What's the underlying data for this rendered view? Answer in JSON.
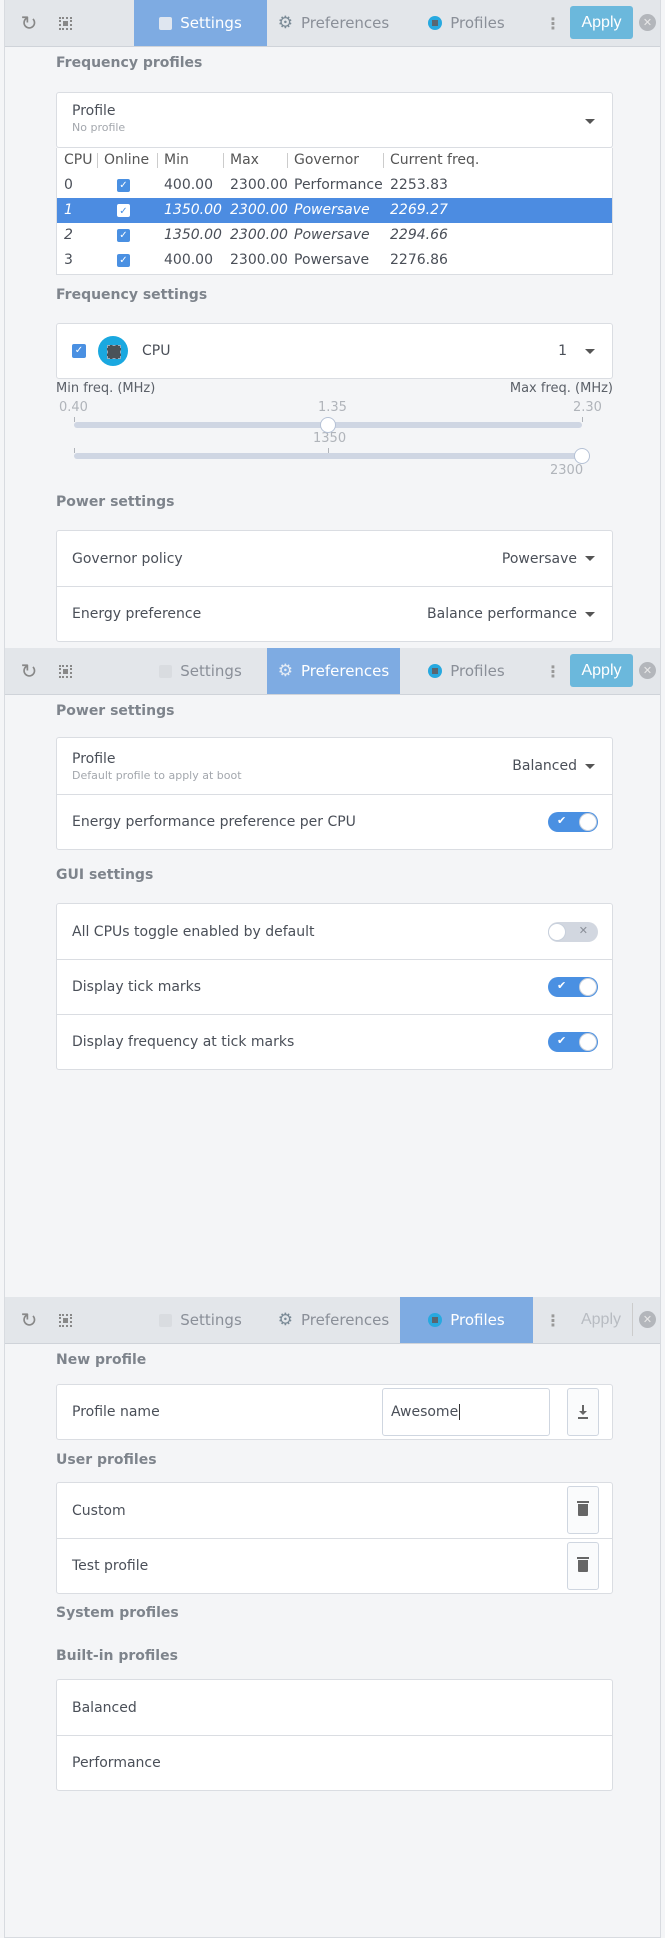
{
  "header": {
    "refresh_icon": "refresh-icon",
    "select_icon": "select-all-icon",
    "tabs": [
      {
        "label": "Settings",
        "icon": "document-icon"
      },
      {
        "label": "Preferences",
        "icon": "gear-icon"
      },
      {
        "label": "Profiles",
        "icon": "chip-icon"
      }
    ],
    "menu_icon": "kebab-menu-icon",
    "apply_label": "Apply",
    "close_icon": "close-icon"
  },
  "colors": {
    "active_tab": "#7eabe2",
    "apply": "#6bb8dc",
    "accent": "#4a90e2",
    "selected_row": "#4c8ce1",
    "background": "#f4f5f7"
  },
  "settings": {
    "active_tab": "Settings",
    "frequency_profiles": {
      "title": "Frequency profiles",
      "profile_label": "Profile",
      "profile_value": "No profile"
    },
    "table": {
      "columns": [
        "CPU",
        "Online",
        "Min",
        "Max",
        "Governor",
        "Current freq."
      ],
      "rows": [
        {
          "cpu": "0",
          "online": true,
          "min": "400.00",
          "max": "2300.00",
          "governor": "Performance",
          "current": "2253.83",
          "selected": false,
          "italic": false
        },
        {
          "cpu": "1",
          "online": true,
          "min": "1350.00",
          "max": "2300.00",
          "governor": "Powersave",
          "current": "2269.27",
          "selected": true,
          "italic": true
        },
        {
          "cpu": "2",
          "online": true,
          "min": "1350.00",
          "max": "2300.00",
          "governor": "Powersave",
          "current": "2294.66",
          "selected": false,
          "italic": true
        },
        {
          "cpu": "3",
          "online": true,
          "min": "400.00",
          "max": "2300.00",
          "governor": "Powersave",
          "current": "2276.86",
          "selected": false,
          "italic": false
        }
      ]
    },
    "frequency_settings": {
      "title": "Frequency settings",
      "all_cpus_checked": true,
      "cpu_label": "CPU",
      "cpu_value": "1",
      "min_label": "Min freq. (MHz)",
      "max_label": "Max freq. (MHz)",
      "tick_labels": [
        "0.40",
        "1.35",
        "2.30"
      ],
      "range_min": 400,
      "range_max": 2300,
      "min_value": 1350,
      "max_value": 2300,
      "min_value_label": "1350",
      "max_value_label": "2300"
    },
    "power_settings": {
      "title": "Power settings",
      "governor_label": "Governor policy",
      "governor_value": "Powersave",
      "energy_label": "Energy preference",
      "energy_value": "Balance performance"
    }
  },
  "preferences": {
    "active_tab": "Preferences",
    "power_settings": {
      "title": "Power settings",
      "profile_label": "Profile",
      "profile_sub": "Default profile to apply at boot",
      "profile_value": "Balanced",
      "epp_label": "Energy performance preference per CPU",
      "epp_on": true
    },
    "gui_settings": {
      "title": "GUI settings",
      "items": [
        {
          "label": "All CPUs toggle enabled by default",
          "on": false
        },
        {
          "label": "Display tick marks",
          "on": true
        },
        {
          "label": "Display frequency at tick marks",
          "on": true
        }
      ]
    }
  },
  "profiles": {
    "active_tab": "Profiles",
    "apply_disabled": true,
    "new_profile": {
      "title": "New profile",
      "name_label": "Profile name",
      "name_value": "Awesome",
      "save_icon": "download-icon"
    },
    "user_profiles": {
      "title": "User profiles",
      "items": [
        "Custom",
        "Test profile"
      ],
      "delete_icon": "trash-icon"
    },
    "system_profiles": {
      "title": "System profiles"
    },
    "builtin_profiles": {
      "title": "Built-in profiles",
      "items": [
        "Balanced",
        "Performance"
      ]
    }
  }
}
